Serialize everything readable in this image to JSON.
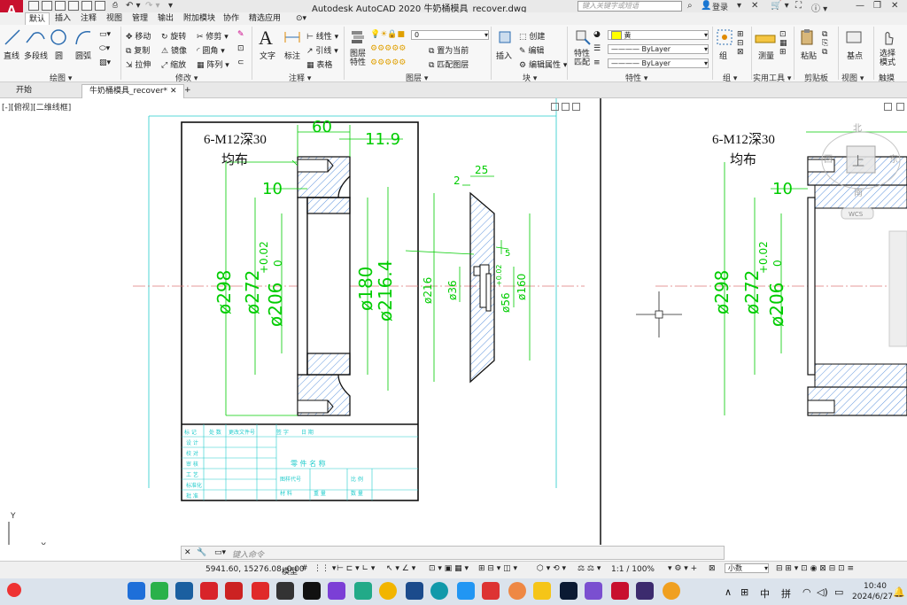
{
  "window": {
    "title": "Autodesk AutoCAD 2020    牛奶桶模具_recover.dwg",
    "logo": "A",
    "search_placeholder": "键入关键字或短语",
    "login": "登录"
  },
  "ribbon_tabs": [
    "默认",
    "插入",
    "注释",
    "视图",
    "管理",
    "输出",
    "附加模块",
    "协作",
    "精选应用"
  ],
  "ribbon": {
    "draw": {
      "line": "直线",
      "polyline": "多段线",
      "circle": "圆",
      "arc": "圆弧",
      "group_label": "绘图 ▾"
    },
    "modify": {
      "move": "移动",
      "rotate": "旋转",
      "trim": "修剪",
      "copy": "复制",
      "mirror": "镜像",
      "fillet": "圆角",
      "stretch": "拉伸",
      "scale": "缩放",
      "array": "阵列",
      "group_label": "修改 ▾"
    },
    "annotation": {
      "text": "文字",
      "dimension": "标注",
      "linear": "线性",
      "leader": "引线",
      "table": "表格",
      "group_label": "注释 ▾"
    },
    "layers": {
      "layer_props": "图层特性",
      "current_layer": "0",
      "make_current": "置为当前",
      "match_layer": "匹配图层",
      "group_label": "图层 ▾"
    },
    "block": {
      "insert": "插入",
      "create": "创建",
      "edit": "编辑",
      "edit_attr": "编辑属性",
      "group_label": "块 ▾"
    },
    "properties": {
      "match": "特性匹配",
      "color": "黄",
      "linetype": "ByLayer",
      "lineweight": "ByLayer",
      "group_label": "特性 ▾"
    },
    "groups": {
      "group": "组",
      "group_label": "组 ▾"
    },
    "utilities": {
      "measure": "测量",
      "group_label": "实用工具 ▾"
    },
    "clipboard": {
      "paste": "粘贴",
      "group_label": "剪贴板"
    },
    "view": {
      "base": "基点",
      "group_label": "视图 ▾"
    },
    "select": {
      "select_mode": "选择模式",
      "group_label": "触摸"
    }
  },
  "doc_tabs": {
    "start": "开始",
    "drawing": "牛奶桶模具_recover*"
  },
  "viewport_label": "[-][俯视][二维线框]",
  "drawing": {
    "note_line1": "6-M12深30",
    "note_line2": "均布",
    "dim_60": "60",
    "dim_11_9": "11.9",
    "dim_10": "10",
    "dim_298": "ø298",
    "dim_272": "ø272",
    "dim_206": "ø206",
    "tol_upper": "+0.02",
    "tol_lower": "0",
    "dim_180": "ø180",
    "dim_216_4": "ø216.4",
    "dim_25": "25",
    "dim_2": "2",
    "dim_216": "ø216",
    "dim_36": "ø36",
    "dim_56": "ø56",
    "dim_56_tol": "+0.02",
    "dim_160": "ø160",
    "dim_5": "5",
    "viewcube_top": "上",
    "viewcube_n": "北",
    "viewcube_e": "东",
    "viewcube_s": "南",
    "viewcube_w": "西",
    "wcs": "WCS",
    "title_block": [
      "设 计",
      "校 对",
      "审 核",
      "工 艺",
      "标准化",
      "批 准",
      "处 数",
      "更改文件号",
      "签 字",
      "日 期",
      "零 件 名 称",
      "图样代号",
      "材 料",
      "重 量",
      "比 例",
      "数 量"
    ]
  },
  "cmdline": {
    "placeholder": "键入命令"
  },
  "status": {
    "coords": "5941.60, 15276.08, 0.00",
    "model": "模型",
    "scale": "1:1 / 100%",
    "units": "小数"
  },
  "taskbar": {
    "ime1": "中",
    "ime2": "拼",
    "time": "10:40",
    "date": "2024/6/27"
  }
}
